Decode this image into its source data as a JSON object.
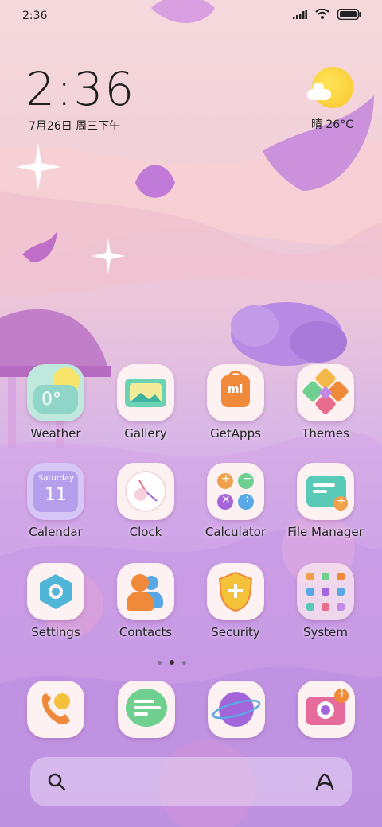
{
  "status_bar": {
    "time": "2:36",
    "icons": [
      "signal-icon",
      "wifi-icon",
      "battery-icon"
    ]
  },
  "clock_widget": {
    "time": "2:36",
    "date": "7月26日 周三下午"
  },
  "weather_widget": {
    "condition_temp": "晴 26°C"
  },
  "apps": [
    {
      "label": "Weather",
      "icon": "weather-icon",
      "icon_text": "0°"
    },
    {
      "label": "Gallery",
      "icon": "gallery-icon"
    },
    {
      "label": "GetApps",
      "icon": "getapps-icon",
      "icon_text": "mi"
    },
    {
      "label": "Themes",
      "icon": "themes-icon"
    },
    {
      "label": "Calendar",
      "icon": "calendar-icon",
      "icon_text": "Saturday",
      "icon_day": "11"
    },
    {
      "label": "Clock",
      "icon": "clock-icon"
    },
    {
      "label": "Calculator",
      "icon": "calculator-icon"
    },
    {
      "label": "File Manager",
      "icon": "file-manager-icon"
    },
    {
      "label": "Settings",
      "icon": "settings-icon"
    },
    {
      "label": "Contacts",
      "icon": "contacts-icon"
    },
    {
      "label": "Security",
      "icon": "security-icon"
    },
    {
      "label": "System",
      "icon": "system-folder-icon"
    }
  ],
  "page_indicator": {
    "pages": 3,
    "active": 2
  },
  "dock": [
    {
      "icon": "phone-icon"
    },
    {
      "icon": "messages-icon"
    },
    {
      "icon": "browser-icon"
    },
    {
      "icon": "camera-icon"
    }
  ],
  "search_bar": {
    "left_icon": "search-icon",
    "right_icon": "assistant-icon"
  },
  "colors": {
    "accent_orange": "#f08a3a",
    "accent_purple": "#a365d9",
    "icon_bg": "#fdf1f1"
  }
}
